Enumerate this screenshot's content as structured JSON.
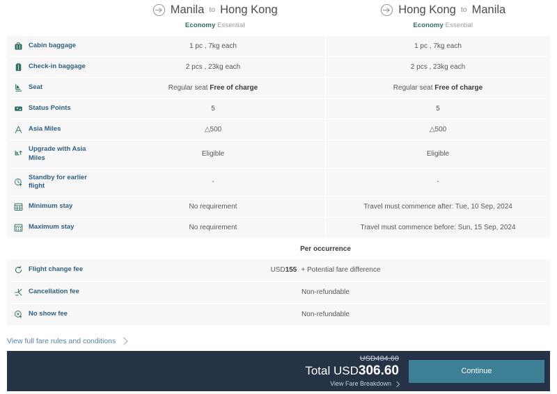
{
  "flights": [
    {
      "origin": "Manila",
      "to": "to",
      "destination": "Hong Kong",
      "cabin_bold": "Economy",
      "cabin_rest": "Essential",
      "icon": "plane-circle-icon"
    },
    {
      "origin": "Hong Kong",
      "to": "to",
      "destination": "Manila",
      "cabin_bold": "Economy",
      "cabin_rest": "Essential",
      "icon": "plane-circle-icon"
    }
  ],
  "rows": [
    {
      "label": "Cabin baggage",
      "icon": "cabin-baggage-icon",
      "left": "1 pc , 7kg each",
      "right": "1 pc , 7kg each"
    },
    {
      "label": "Check-in baggage",
      "icon": "checkin-baggage-icon",
      "left": "2 pcs , 23kg each",
      "right": "2 pcs , 23kg each"
    },
    {
      "label": "Seat",
      "icon": "seat-icon",
      "left_plain": "Regular seat ",
      "left_bold": "Free of charge",
      "right_plain": "Regular seat ",
      "right_bold": "Free of charge"
    },
    {
      "label": "Status Points",
      "icon": "status-points-icon",
      "left": "5",
      "right": "5"
    },
    {
      "label": "Asia Miles",
      "icon": "asia-miles-icon",
      "left": "△500",
      "right": "△500"
    },
    {
      "label": "Upgrade with Asia Miles",
      "icon": "upgrade-miles-icon",
      "left": "Eligible",
      "right": "Eligible"
    },
    {
      "label": "Standby for earlier flight",
      "icon": "standby-icon",
      "left": "-",
      "right": "-"
    },
    {
      "label": "Minimum stay",
      "icon": "minimum-stay-icon",
      "left": "No requirement",
      "right": "Travel must commence after: Tue, 10 Sep, 2024"
    },
    {
      "label": "Maximum stay",
      "icon": "maximum-stay-icon",
      "left": "No requirement",
      "right": "Travel must commence before: Sun, 15 Sep, 2024"
    }
  ],
  "per_occurrence_title": "Per occurrence",
  "fee_rows": [
    {
      "label": "Flight change fee",
      "icon": "flight-change-icon",
      "amount_cur": "USD",
      "amount_val": "155",
      "extra": "+ Potential fare difference"
    },
    {
      "label": "Cancellation fee",
      "icon": "cancellation-icon",
      "value": "Non-refundable"
    },
    {
      "label": "No show fee",
      "icon": "no-show-icon",
      "value": "Non-refundable"
    }
  ],
  "rules_link": {
    "label": "View full fare rules and conditions",
    "icon": "chevron-right-icon"
  },
  "footer": {
    "old_price": "USD484.60",
    "total_label": "Total ",
    "total_currency": "USD",
    "total_amount": "306.60",
    "breakdown_label": "View Fare Breakdown",
    "breakdown_icon": "chevron-right-icon",
    "continue_label": "Continue",
    "bar_color": "#263245",
    "button_color": "#3d7f94"
  }
}
